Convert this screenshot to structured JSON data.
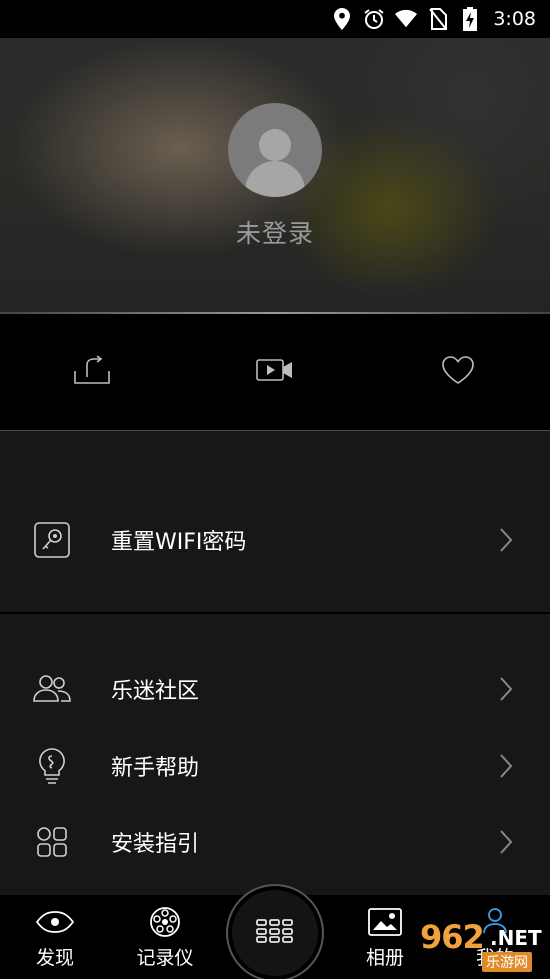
{
  "status_bar": {
    "time": "3:08",
    "icons": [
      "location-icon",
      "alarm-icon",
      "wifi-icon",
      "no-sim-icon",
      "battery-charging-icon"
    ]
  },
  "profile": {
    "login_text": "未登录",
    "avatar_icon": "default-avatar-icon"
  },
  "quick_actions": [
    {
      "icon": "upload-icon"
    },
    {
      "icon": "video-icon"
    },
    {
      "icon": "heart-icon"
    }
  ],
  "menu": {
    "reset_wifi": {
      "label": "重置WIFI密码",
      "icon": "key-icon"
    },
    "community": {
      "label": "乐迷社区",
      "icon": "users-icon"
    },
    "help": {
      "label": "新手帮助",
      "icon": "lightbulb-icon"
    },
    "install_guide": {
      "label": "安装指引",
      "icon": "grid-icon"
    }
  },
  "tabs": {
    "discover": {
      "label": "发现",
      "icon": "eye-icon"
    },
    "recorder": {
      "label": "记录仪",
      "icon": "camera-lens-icon"
    },
    "album": {
      "label": "相册",
      "icon": "picture-icon"
    },
    "me": {
      "label": "我的",
      "icon": "person-pin-icon"
    }
  },
  "watermark": {
    "num": "962",
    "net": ".NET",
    "sub": "乐游网"
  },
  "colors": {
    "accent_watermark": "#f2a23a",
    "menu_bg": "#171717",
    "text_muted": "#9a9a9a"
  }
}
